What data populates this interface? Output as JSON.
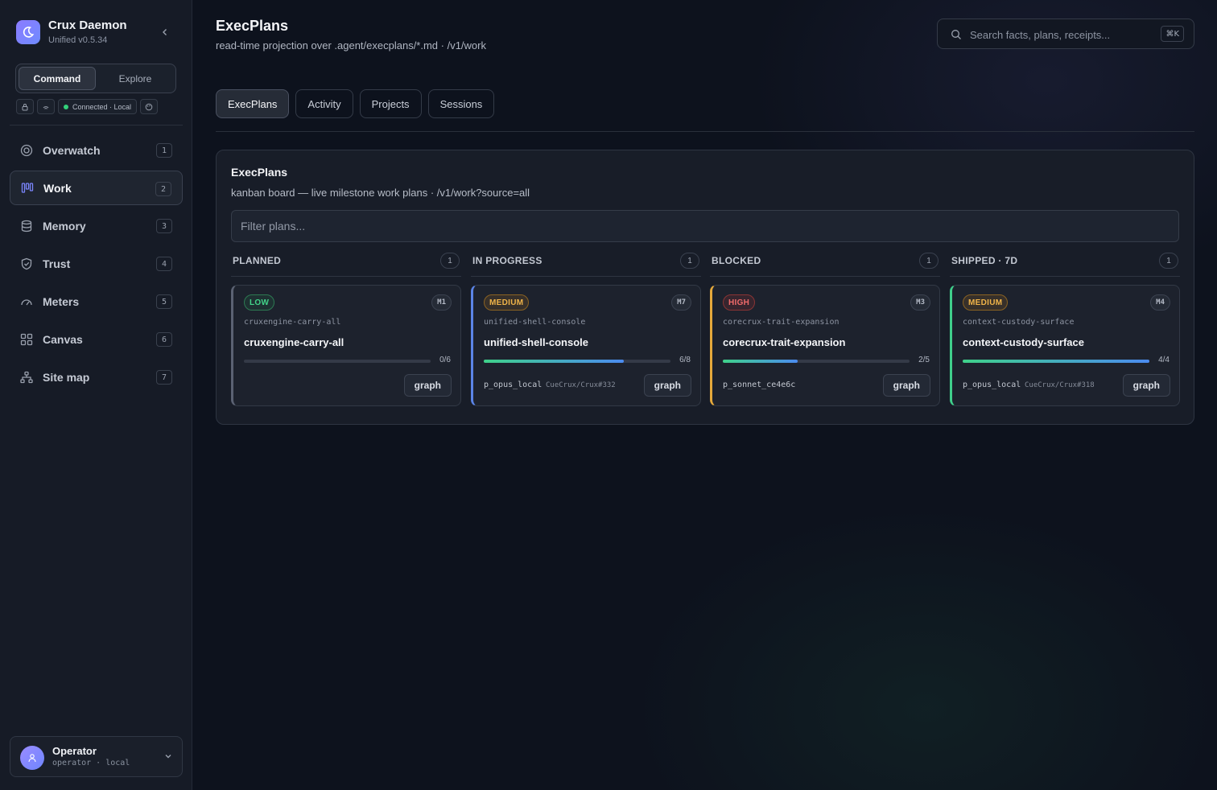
{
  "brand": {
    "name": "Crux Daemon",
    "version": "Unified v0.5.34"
  },
  "modes": {
    "active": "Command",
    "other": "Explore"
  },
  "status": {
    "connection": "Connected · Local",
    "connection_color": "#33d17a"
  },
  "nav": [
    {
      "label": "Overwatch",
      "count": "1",
      "icon": "target-icon"
    },
    {
      "label": "Work",
      "count": "2",
      "icon": "kanban-icon",
      "active": true
    },
    {
      "label": "Memory",
      "count": "3",
      "icon": "database-icon"
    },
    {
      "label": "Trust",
      "count": "4",
      "icon": "shield-icon"
    },
    {
      "label": "Meters",
      "count": "5",
      "icon": "gauge-icon"
    },
    {
      "label": "Canvas",
      "count": "6",
      "icon": "grid-icon"
    },
    {
      "label": "Site map",
      "count": "7",
      "icon": "sitemap-icon"
    }
  ],
  "user": {
    "name": "Operator",
    "sub": "operator · local"
  },
  "header": {
    "title": "ExecPlans",
    "subtitle": "read-time projection over .agent/execplans/*.md · /v1/work"
  },
  "search": {
    "placeholder": "Search facts, plans, receipts...",
    "shortcut": "⌘K"
  },
  "tabs": [
    "ExecPlans",
    "Activity",
    "Projects",
    "Sessions"
  ],
  "panel": {
    "title": "ExecPlans",
    "subtitle": "kanban board — live milestone work plans · /v1/work?source=all",
    "filter_placeholder": "Filter plans..."
  },
  "columns": [
    {
      "title": "PLANNED",
      "count": "1",
      "card": {
        "priority": "LOW",
        "milestone": "M1",
        "slug": "cruxengine-carry-all",
        "name": "cruxengine-carry-all",
        "progress": "0/6",
        "progress_fraction": 0.0,
        "agent": "",
        "ref": "",
        "action": "graph"
      }
    },
    {
      "title": "IN PROGRESS",
      "count": "1",
      "card": {
        "priority": "MEDIUM",
        "milestone": "M7",
        "slug": "unified-shell-console",
        "name": "unified-shell-console",
        "progress": "6/8",
        "progress_fraction": 0.75,
        "agent": "p_opus_local",
        "ref": "CueCrux/Crux#332",
        "action": "graph"
      }
    },
    {
      "title": "BLOCKED",
      "count": "1",
      "card": {
        "priority": "HIGH",
        "milestone": "M3",
        "slug": "corecrux-trait-expansion",
        "name": "corecrux-trait-expansion",
        "progress": "2/5",
        "progress_fraction": 0.4,
        "agent": "p_sonnet_ce4e6c",
        "ref": "",
        "action": "graph"
      }
    },
    {
      "title": "SHIPPED · 7D",
      "count": "1",
      "card": {
        "priority": "MEDIUM",
        "milestone": "M4",
        "slug": "context-custody-surface",
        "name": "context-custody-surface",
        "progress": "4/4",
        "progress_fraction": 1.0,
        "agent": "p_opus_local",
        "ref": "CueCrux/Crux#318",
        "action": "graph"
      }
    }
  ],
  "colors": {
    "accent": "#7b86ff",
    "planned": "#5b6273",
    "in_progress": "#5b84e6",
    "blocked": "#e5a93b",
    "shipped": "#3fcf8b"
  }
}
